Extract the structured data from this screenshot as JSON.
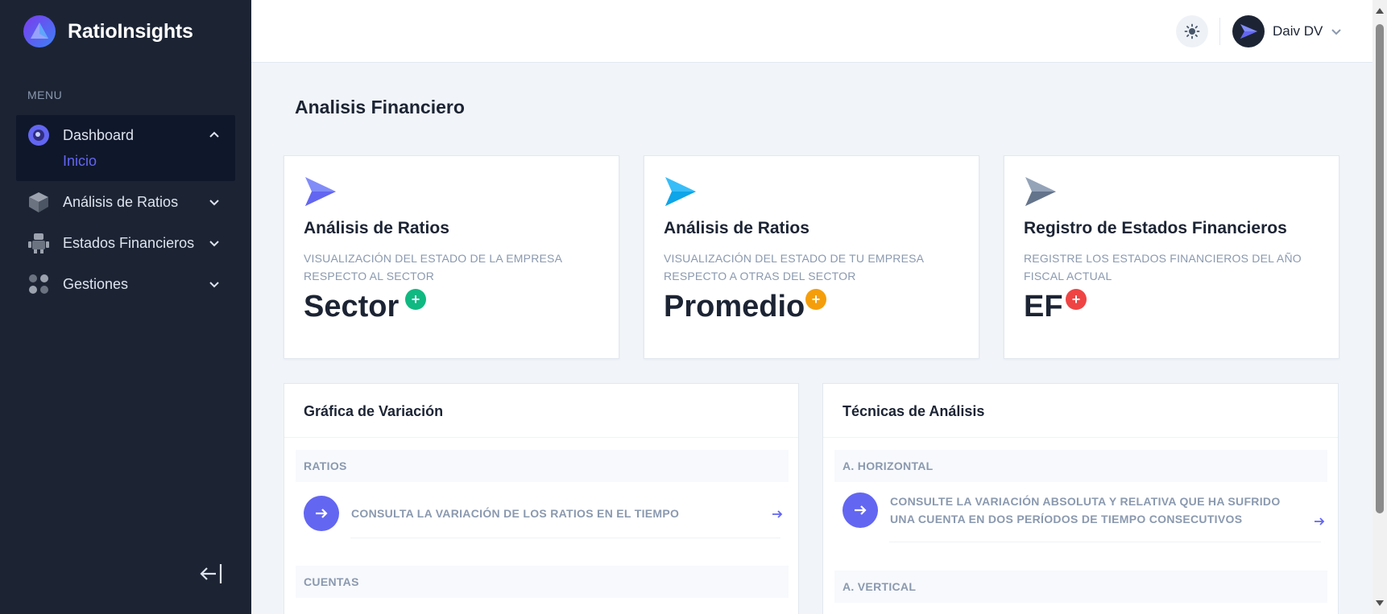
{
  "app": {
    "name": "RatioInsights"
  },
  "sidebar": {
    "menu_label": "MENU",
    "items": [
      {
        "label": "Dashboard",
        "icon": "dashboard-icon",
        "expanded": true,
        "sub": [
          "Inicio"
        ]
      },
      {
        "label": "Análisis de Ratios",
        "icon": "cube-icon"
      },
      {
        "label": "Estados Financieros",
        "icon": "robot-icon"
      },
      {
        "label": "Gestiones",
        "icon": "dots-grid-icon"
      }
    ]
  },
  "header": {
    "user_name": "Daiv DV"
  },
  "page": {
    "title": "Analisis Financiero"
  },
  "cards": [
    {
      "title": "Análisis de Ratios",
      "desc": "VISUALIZACIÓN DEL ESTADO DE LA EMPRESA RESPECTO AL SECTOR",
      "value": "Sector",
      "badge": "+",
      "badge_color": "#10b981"
    },
    {
      "title": "Análisis de Ratios",
      "desc": "VISUALIZACIÓN DEL ESTADO DE TU EMPRESA RESPECTO A OTRAS DEL SECTOR",
      "value": "Promedio",
      "badge": "+",
      "badge_color": "#f59e0b"
    },
    {
      "title": "Registro de Estados Financieros",
      "desc": "REGISTRE LOS ESTADOS FINANCIEROS DEL AÑO FISCAL ACTUAL",
      "value": "EF",
      "badge": "+",
      "badge_color": "#ef4444"
    }
  ],
  "panels": {
    "variation": {
      "title": "Gráfica de Variación",
      "sections": [
        {
          "label": "RATIOS",
          "link": "CONSULTA LA VARIACIÓN DE LOS RATIOS EN EL TIEMPO"
        },
        {
          "label": "CUENTAS"
        }
      ]
    },
    "techniques": {
      "title": "Técnicas de Análisis",
      "sections": [
        {
          "label": "A. HORIZONTAL",
          "link": "CONSULTE LA VARIACIÓN ABSOLUTA Y RELATIVA QUE HA SUFRIDO UNA CUENTA EN DOS PERÍODOS DE TIEMPO CONSECUTIVOS"
        },
        {
          "label": "A. VERTICAL"
        }
      ]
    }
  },
  "colors": {
    "sidebar_bg": "#1c2434",
    "accent": "#6366f1",
    "text_muted": "#8a99af"
  }
}
